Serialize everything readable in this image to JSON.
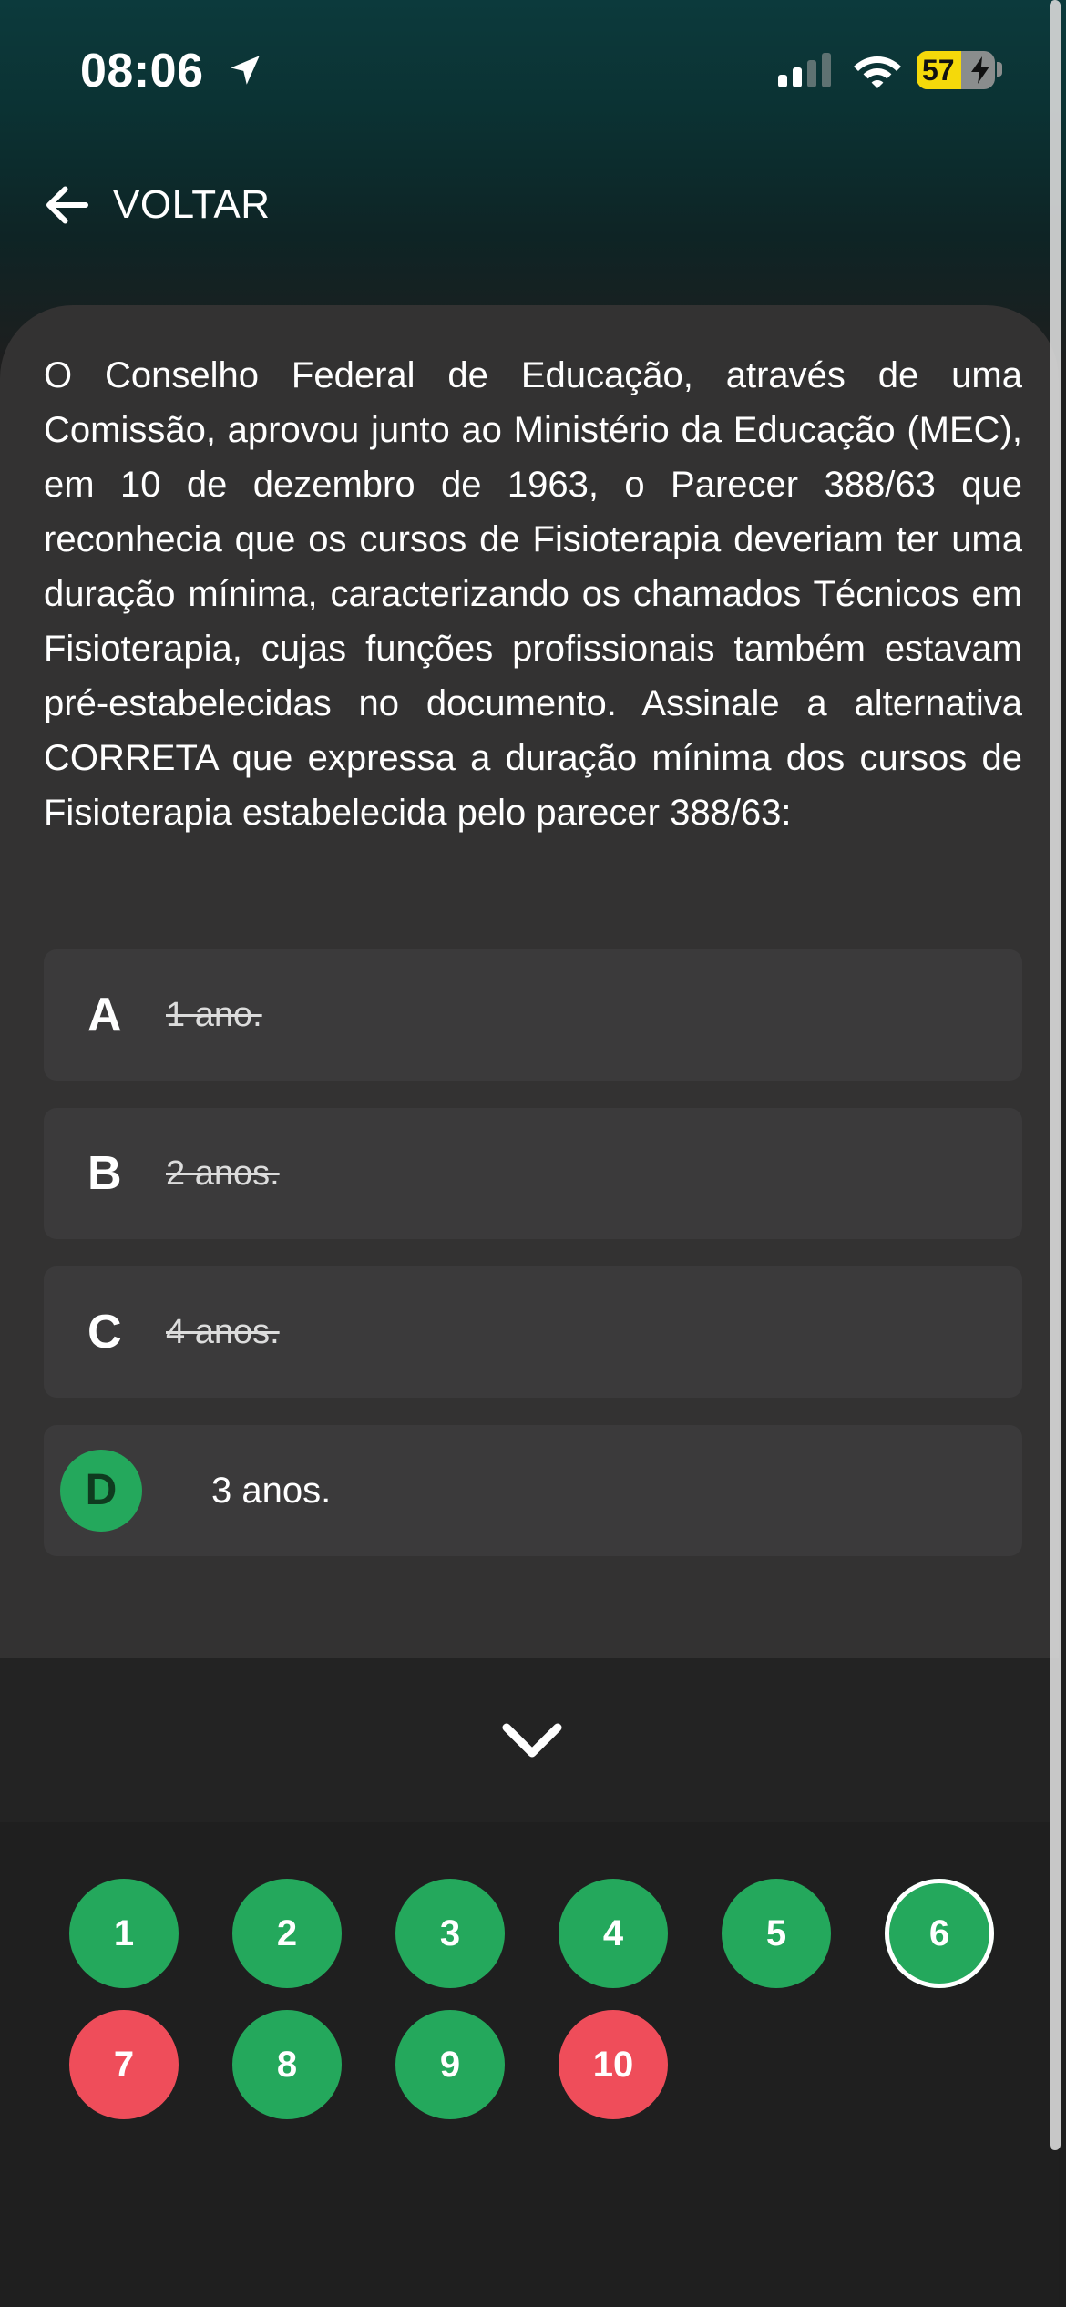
{
  "status_bar": {
    "time": "08:06",
    "battery_percent": "57",
    "battery_level": 0.57,
    "icons": [
      "location-arrow-icon",
      "cellular-signal-icon",
      "wifi-icon",
      "battery-charging-icon"
    ]
  },
  "header": {
    "back_label": "VOLTAR",
    "back_icon": "arrow-left-icon"
  },
  "question": {
    "text": "O Conselho Federal de Educação, através de uma Comissão, aprovou junto ao Ministério da Educação (MEC), em 10 de dezembro de 1963, o Parecer 388/63 que reconhecia que os cursos de Fisioterapia deveriam ter uma duração mínima, caracterizando os chamados Técnicos em Fisioterapia, cujas funções profissionais também estavam pré-estabelecidas no documento. Assinale a alternativa CORRETA que expressa a duração mínima dos cursos de Fisioterapia estabelecida pelo parecer 388/63:"
  },
  "options": [
    {
      "letter": "A",
      "text": "1 ano.",
      "state": "eliminated"
    },
    {
      "letter": "B",
      "text": "2 anos.",
      "state": "eliminated"
    },
    {
      "letter": "C",
      "text": "4 anos.",
      "state": "eliminated"
    },
    {
      "letter": "D",
      "text": "3 anos.",
      "state": "correct"
    }
  ],
  "navigator": {
    "collapse_icon": "chevron-down-icon",
    "questions": [
      {
        "number": "1",
        "status": "correct"
      },
      {
        "number": "2",
        "status": "correct"
      },
      {
        "number": "3",
        "status": "correct"
      },
      {
        "number": "4",
        "status": "correct"
      },
      {
        "number": "5",
        "status": "correct"
      },
      {
        "number": "6",
        "status": "correct",
        "current": true
      },
      {
        "number": "7",
        "status": "wrong"
      },
      {
        "number": "8",
        "status": "correct"
      },
      {
        "number": "9",
        "status": "correct"
      },
      {
        "number": "10",
        "status": "wrong"
      }
    ]
  },
  "colors": {
    "correct": "#24a85c",
    "wrong": "#ef4d5a",
    "card": "#333232",
    "option_bg": "#3b3a3b",
    "battery": "#f5d90a"
  }
}
